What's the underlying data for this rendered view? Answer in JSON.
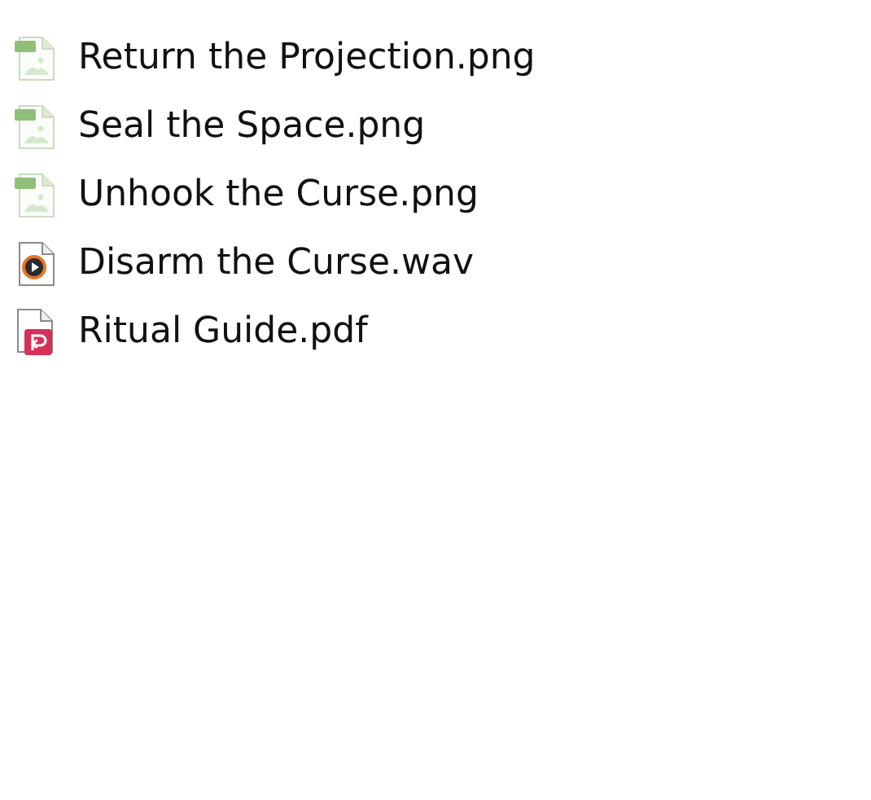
{
  "files": [
    {
      "name": "Return the Projection.png",
      "kind": "image"
    },
    {
      "name": "Seal the Space.png",
      "kind": "image"
    },
    {
      "name": "Unhook the Curse.png",
      "kind": "image"
    },
    {
      "name": "Disarm the Curse.wav",
      "kind": "audio"
    },
    {
      "name": "Ritual Guide.pdf",
      "kind": "pdf"
    }
  ]
}
